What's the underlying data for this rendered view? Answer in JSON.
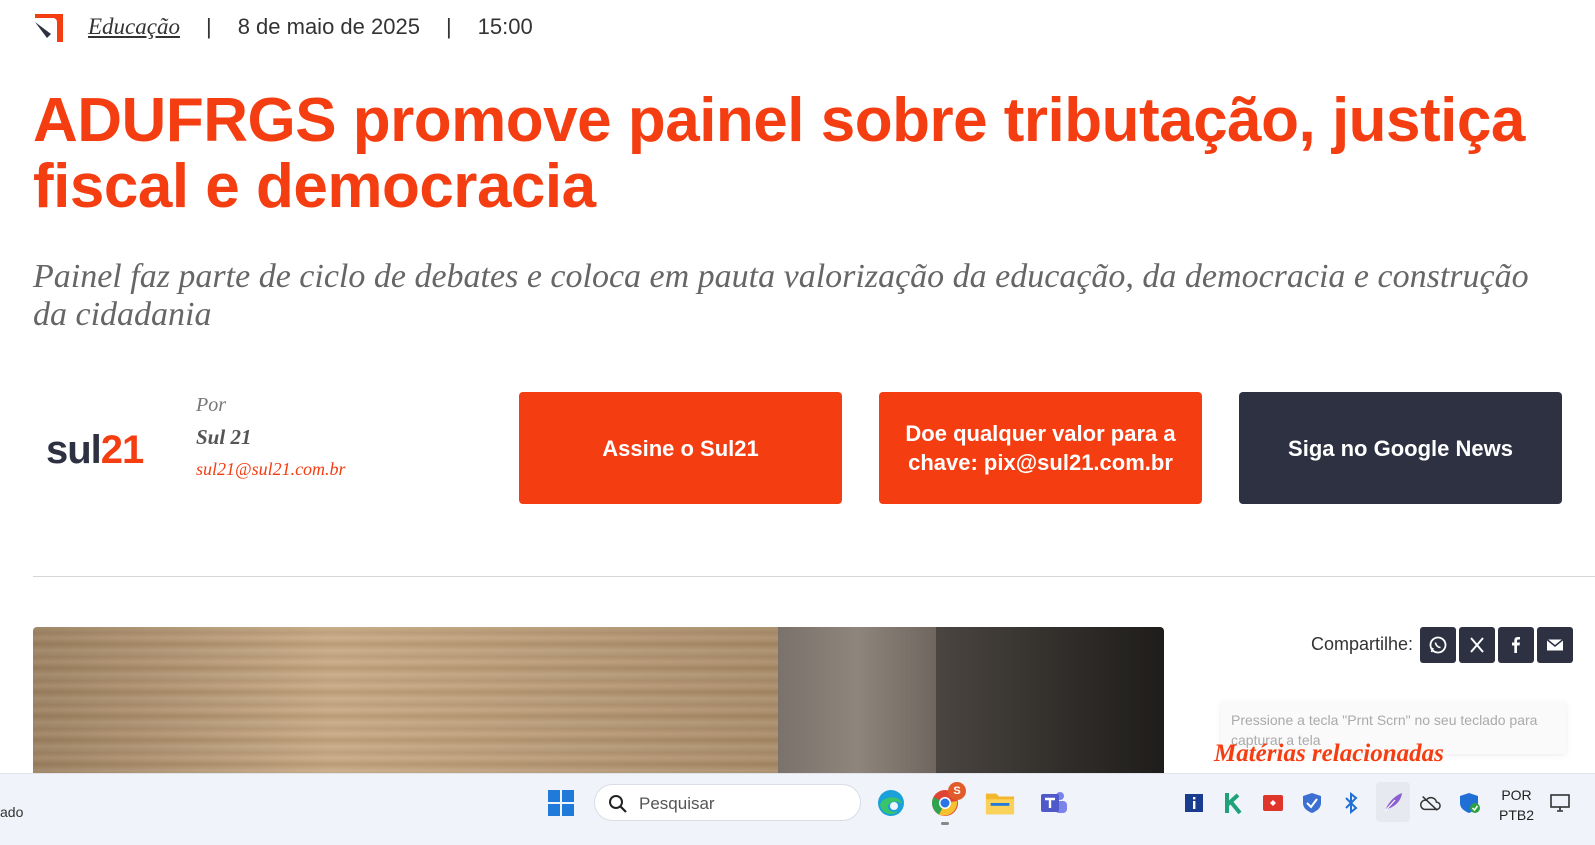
{
  "header": {
    "category": "Educação",
    "separator": "|",
    "date": "8 de maio de 2025",
    "time": "15:00"
  },
  "article": {
    "title": "ADUFRGS promove painel sobre tributação, justiça fiscal e democracia",
    "subtitle": "Painel faz parte de ciclo de debates e coloca em pauta valorização da educação, da democracia e construção da cidadania"
  },
  "author": {
    "logo_sul": "sul",
    "logo_num": "21",
    "by_label": "Por",
    "name": "Sul 21",
    "email": "sul21@sul21.com.br"
  },
  "cta": {
    "subscribe": "Assine o Sul21",
    "donate": "Doe qualquer valor para a chave: pix@sul21.com.br",
    "google_news": "Siga no Google News"
  },
  "share": {
    "label": "Compartilhe:",
    "buttons": [
      "whatsapp-icon",
      "x-icon",
      "facebook-icon",
      "email-icon"
    ]
  },
  "toast": {
    "text": "Pressione a tecla \"Prnt Scrn\" no seu teclado para capturar a tela"
  },
  "related": {
    "heading": "Matérias relacionadas"
  },
  "taskbar": {
    "left_fragment": "ado",
    "search_placeholder": "Pesquisar",
    "chrome_badge": "S",
    "lang_line1": "POR",
    "lang_line2": "PTB2"
  },
  "colors": {
    "accent": "#f53d12",
    "dark": "#2d3142"
  }
}
